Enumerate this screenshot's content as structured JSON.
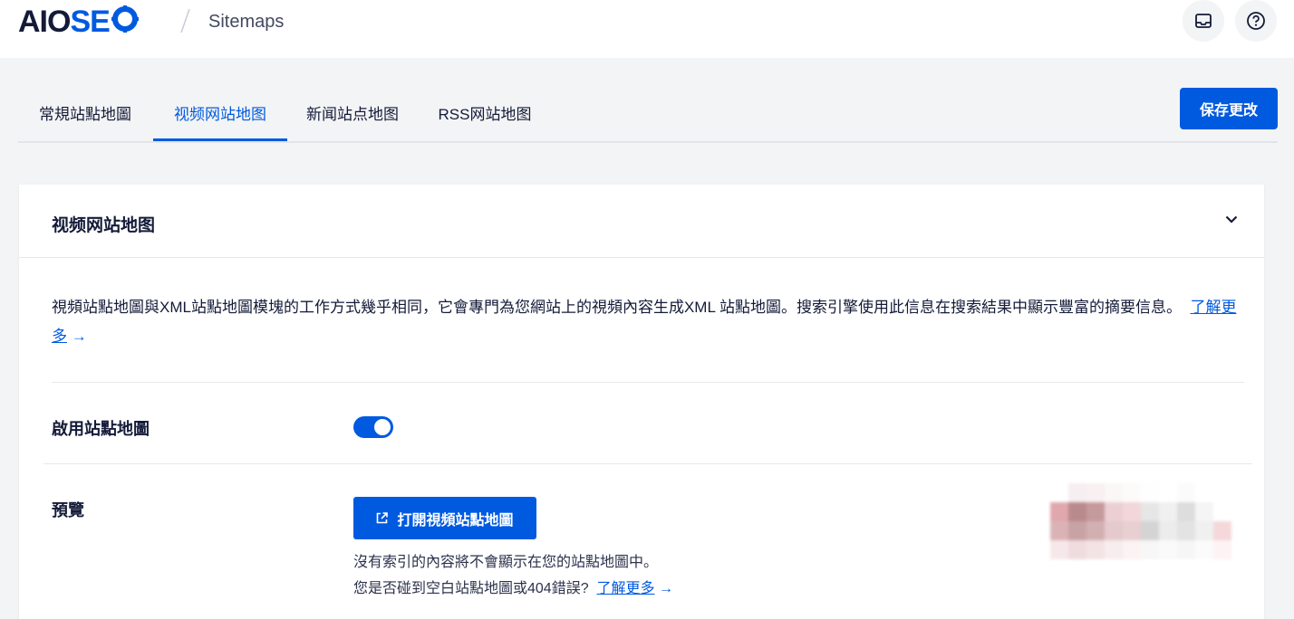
{
  "header": {
    "logo_left": "AIO",
    "logo_right": "SE",
    "breadcrumb": "Sitemaps",
    "icons": [
      "inbox-icon",
      "help-icon"
    ]
  },
  "tabs": [
    {
      "label": "常規站點地圖",
      "active": false
    },
    {
      "label": "视频网站地图",
      "active": true
    },
    {
      "label": "新闻站点地图",
      "active": false
    },
    {
      "label": "RSS网站地图",
      "active": false
    }
  ],
  "save_button": "保存更改",
  "card": {
    "title": "视频网站地图",
    "description": "視頻站點地圖與XML站點地圖模塊的工作方式幾乎相同，它會專門為您網站上的視頻內容生成XML 站點地圖。搜索引擎使用此信息在搜索結果中顯示豐富的摘要信息。",
    "learn_more": "了解更多",
    "arrow": "→"
  },
  "enable_row": {
    "label": "啟用站點地圖",
    "enabled": true
  },
  "preview_row": {
    "label": "預覽",
    "button": "打開視頻站點地圖",
    "note_line1": "沒有索引的內容將不會顯示在您的站點地圖中。",
    "note_line2": "您是否碰到空白站點地圖或404錯誤?",
    "learn_more": "了解更多",
    "arrow": "→"
  },
  "colors": {
    "accent": "#005ae0",
    "text": "#141b38",
    "background": "#f3f4f5"
  }
}
